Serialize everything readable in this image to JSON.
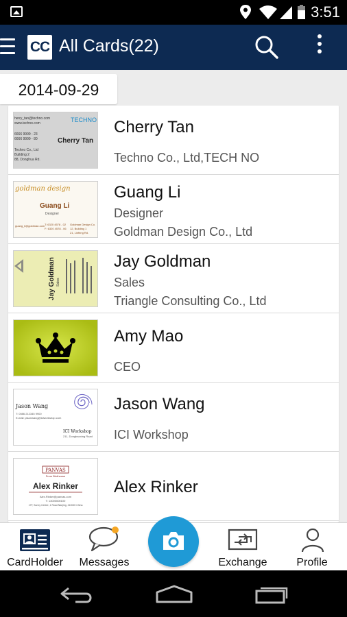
{
  "status_bar": {
    "time": "3:51"
  },
  "app_bar": {
    "logo": "CC",
    "title": "All Cards(22)"
  },
  "date_header": "2014-09-29",
  "cards": [
    {
      "name": "Cherry Tan",
      "lines": [
        "Techno Co., Ltd,TECH NO"
      ],
      "thumb": {
        "brand": "TECHNO",
        "name": "Cherry Tan",
        "small": [
          "herry_tan@techno.com",
          "www.techno.com",
          "6666 9999 - 23",
          "6666 9999 - 80",
          "Techno Co., Ltd",
          "Building 2",
          "88, Donghua Rd."
        ]
      }
    },
    {
      "name": "Guang Li",
      "lines": [
        "Designer",
        "Goldman Design Co., Ltd"
      ],
      "thumb": {
        "brand": "goldman design",
        "name": "Guang Li",
        "title": "Designer",
        "small": [
          "guang_li@goldman.com",
          "T: 6320 4578 - 02",
          "F: 6320 4578 - 06",
          "Goldman Design Co.",
          "12, Building 1",
          "21, Linfeng Rd."
        ]
      }
    },
    {
      "name": "Jay Goldman",
      "lines": [
        "Sales",
        "Triangle Consulting Co., Ltd"
      ],
      "thumb": {
        "name": "Jay Goldman",
        "title": "Sales"
      }
    },
    {
      "name": "Amy Mao",
      "lines": [
        "CEO"
      ],
      "thumb": {}
    },
    {
      "name": "Jason Wang",
      "lines": [
        "ICI Workshop"
      ],
      "thumb": {
        "name": "Jason Wang",
        "brand": "ICI Workshop",
        "small": [
          "T: 0086 212345 9900",
          "E-mail: jasonwang@iciworkshop.com",
          "211, Dongbaoxing Road"
        ]
      }
    },
    {
      "name": "Alex Rinker",
      "lines": [],
      "thumb": {
        "brand": "PANVAS",
        "tagline": "From Birdhouse",
        "name": "Alex Rinker",
        "small": [
          "Alex.Rinker@panvas.com",
          "T: 13000000100",
          "17F, Sunny Centre, 1 Road Nanjing, 210000 China"
        ]
      }
    }
  ],
  "bottom_nav": {
    "cardholder": "CardHolder",
    "messages": "Messages",
    "exchange": "Exchange",
    "profile": "Profile"
  },
  "colors": {
    "app_bar": "#0d2a52",
    "accent": "#1f9ad6",
    "badge": "#f5a623"
  }
}
